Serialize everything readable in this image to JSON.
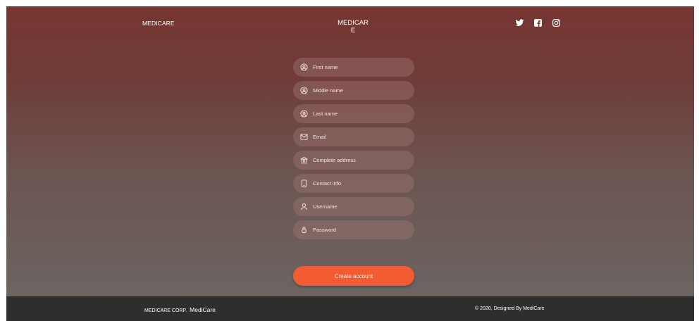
{
  "header": {
    "brand_left": "MEDICARE",
    "brand_center": "MEDICARE",
    "social": [
      "twitter-icon",
      "facebook-icon",
      "instagram-icon"
    ]
  },
  "form": {
    "fields": [
      {
        "placeholder": "First name",
        "icon": "user-circle-icon"
      },
      {
        "placeholder": "Middle name",
        "icon": "user-circle-icon"
      },
      {
        "placeholder": "Last name",
        "icon": "user-circle-icon"
      },
      {
        "placeholder": "Email",
        "icon": "envelope-icon"
      },
      {
        "placeholder": "Complete address",
        "icon": "building-icon"
      },
      {
        "placeholder": "Contact info",
        "icon": "phone-icon"
      },
      {
        "placeholder": "Username",
        "icon": "person-icon"
      },
      {
        "placeholder": "Password",
        "icon": "lock-icon"
      }
    ],
    "submit_label": "Create account"
  },
  "footer": {
    "corp": "MEDICARE CORP.",
    "name": "MediCare",
    "copyright": "© 2020, Designed By MediCare"
  },
  "colors": {
    "accent": "#f15c32",
    "header_top": "#773632",
    "footer_bg": "#2e2e2e"
  }
}
